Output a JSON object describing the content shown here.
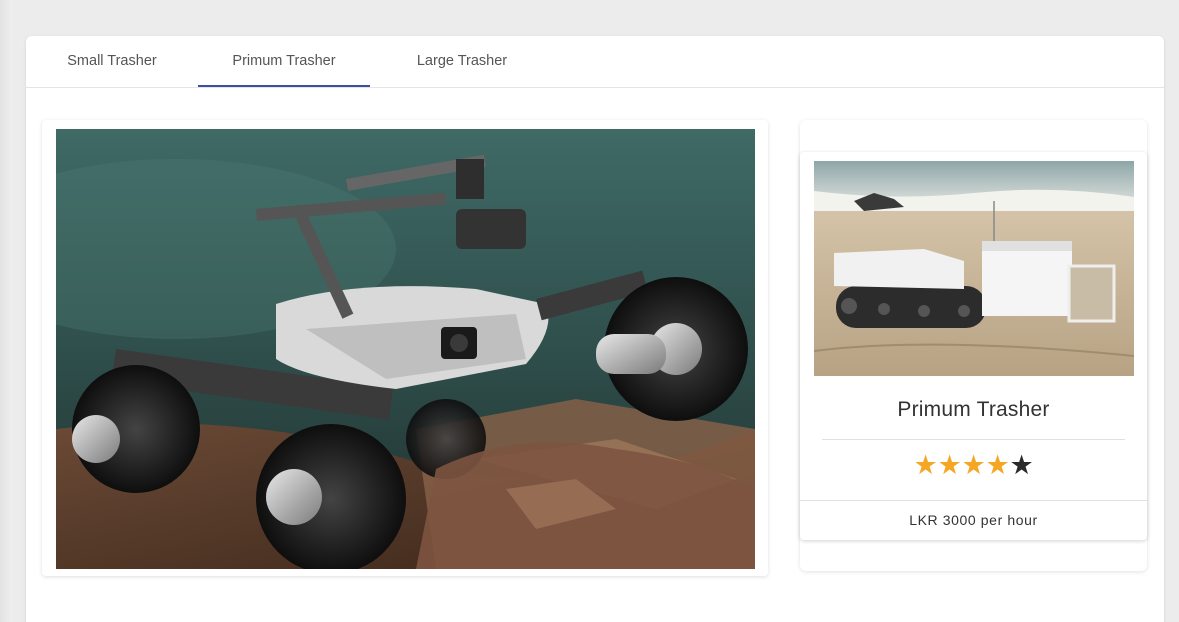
{
  "tabs": [
    {
      "label": "Small Trasher",
      "active": false
    },
    {
      "label": "Primum Trasher",
      "active": true
    },
    {
      "label": "Large Trasher",
      "active": false
    }
  ],
  "product": {
    "title": "Primum Trasher",
    "rating": 4,
    "rating_max": 5,
    "price": "LKR 3000 per hour"
  },
  "colors": {
    "active_tab_underline": "#3f4f9f",
    "star_filled": "#f5a623",
    "star_empty": "#2b2b2b"
  },
  "icons": {
    "star_filled": "star-filled-icon",
    "star_empty": "star-empty-icon"
  }
}
